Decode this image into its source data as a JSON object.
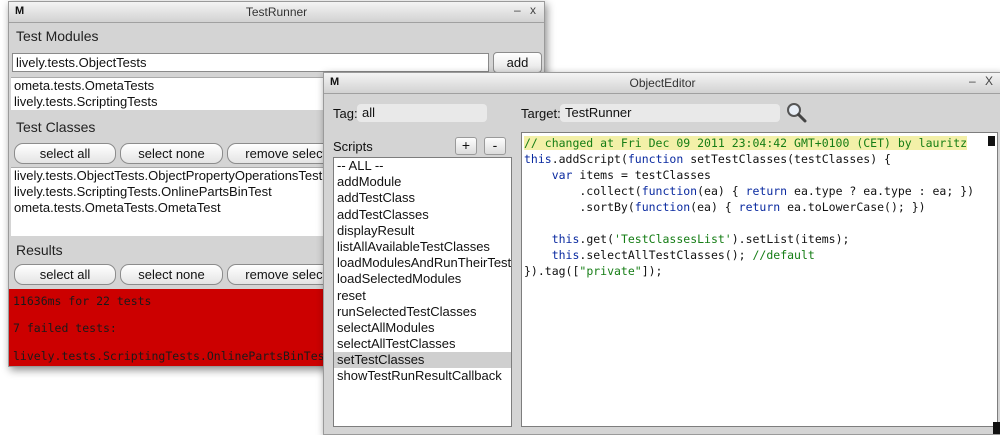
{
  "runner": {
    "icon": "M",
    "title": "TestRunner",
    "minimize": "–",
    "close": "x",
    "modules_label": "Test Modules",
    "module_input_value": "lively.tests.ObjectTests",
    "add_label": "add",
    "modules": [
      "ometa.tests.OmetaTests",
      "lively.tests.ScriptingTests"
    ],
    "classes_label": "Test Classes",
    "select_all": "select all",
    "select_none": "select none",
    "remove_selected": "remove selected",
    "classes": [
      "lively.tests.ObjectTests.ObjectPropertyOperationsTest",
      "lively.tests.ScriptingTests.OnlinePartsBinTest",
      "ometa.tests.OmetaTests.OmetaTest"
    ],
    "results_label": "Results",
    "results_lines": [
      "11636ms for 22 tests",
      "7 failed tests:",
      "lively.tests.ScriptingTests.OnlinePartsBinTest"
    ]
  },
  "editor": {
    "icon": "M",
    "title": "ObjectEditor",
    "minimize": "–",
    "close": "X",
    "tag_label": "Tag:",
    "tag_value": "all",
    "target_label": "Target:",
    "target_value": "TestRunner",
    "search_icon": "magnifier-icon",
    "scripts_label": "Scripts",
    "plus": "+",
    "minus": "-",
    "scripts": [
      "-- ALL --",
      "addModule",
      "addTestClass",
      "addTestClasses",
      "displayResult",
      "listAllAvailableTestClasses",
      "loadModulesAndRunTheirTests",
      "loadSelectedModules",
      "reset",
      "runSelectedTestClasses",
      "selectAllModules",
      "selectAllTestClasses",
      "setTestClasses",
      "showTestRunResultCallback"
    ],
    "selected_script": "setTestClasses",
    "code": {
      "l1": "// changed at Fri Dec 09 2011 23:04:42 GMT+0100 (CET) by lauritz",
      "l2a": "this",
      "l2b": ".addScript(",
      "l2c": "function",
      "l2d": " setTestClasses(testClasses) {",
      "l3a": "    ",
      "l3b": "var",
      "l3c": " items = testClasses",
      "l4a": "        .collect(",
      "l4b": "function",
      "l4c": "(ea) { ",
      "l4d": "return",
      "l4e": " ea.type ? ea.type : ea; })",
      "l5a": "        .sortBy(",
      "l5b": "function",
      "l5c": "(ea) { ",
      "l5d": "return",
      "l5e": " ea.toLowerCase(); })",
      "l7a": "    ",
      "l7b": "this",
      "l7c": ".get(",
      "l7d": "'TestClassesList'",
      "l7e": ").setList(items);",
      "l8a": "    ",
      "l8b": "this",
      "l8c": ".selectAllTestClasses(); ",
      "l8d": "//default",
      "l9a": "}).tag([",
      "l9b": "\"private\"",
      "l9c": "]);"
    }
  },
  "colors": {
    "results_bg": "#cc0000",
    "selected_row": "#cfcfcf",
    "code_keyword": "#0a2aa0",
    "code_comment": "#157d15"
  }
}
